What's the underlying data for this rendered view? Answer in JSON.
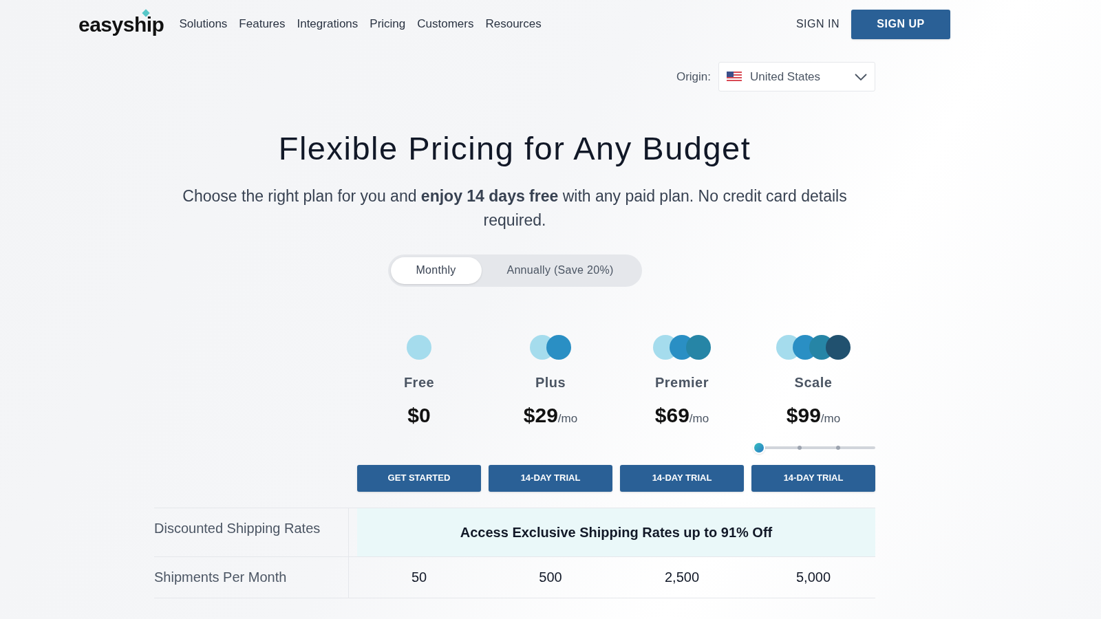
{
  "nav": {
    "logo": "easyship",
    "links": [
      "Solutions",
      "Features",
      "Integrations",
      "Pricing",
      "Customers",
      "Resources"
    ],
    "sign_in": "SIGN IN",
    "sign_up": "SIGN UP"
  },
  "origin": {
    "label": "Origin:",
    "value": "United States"
  },
  "hero": {
    "title": "Flexible Pricing for Any Budget",
    "subtitle": "Choose the right plan for you and **enjoy 14 days free** with any paid plan. No credit card details required."
  },
  "billing_tabs": [
    {
      "label": "Monthly",
      "selected": true
    },
    {
      "label": "Annually (Save 20%)",
      "selected": false
    }
  ],
  "plans": [
    {
      "name": "Free",
      "price": "$0",
      "button": "GET STARTED"
    },
    {
      "name": "Plus",
      "price": "$29",
      "period": "/mo",
      "button": "14-DAY TRIAL"
    },
    {
      "name": "Premier",
      "price": "$69",
      "period": "/mo",
      "button": "14-DAY TRIAL"
    },
    {
      "name": "Scale",
      "price": "$99",
      "period": "/mo",
      "button": "14-DAY TRIAL",
      "slider": {
        "level": 0
      }
    }
  ],
  "table": {
    "rows": [
      {
        "label": "Discounted Shipping Rates",
        "banner": "Access Exclusive Shipping Rates up to 91% Off"
      },
      {
        "label": "Shipments Per Month",
        "values": [
          "50",
          "500",
          "2,500",
          "5,000"
        ]
      }
    ]
  }
}
